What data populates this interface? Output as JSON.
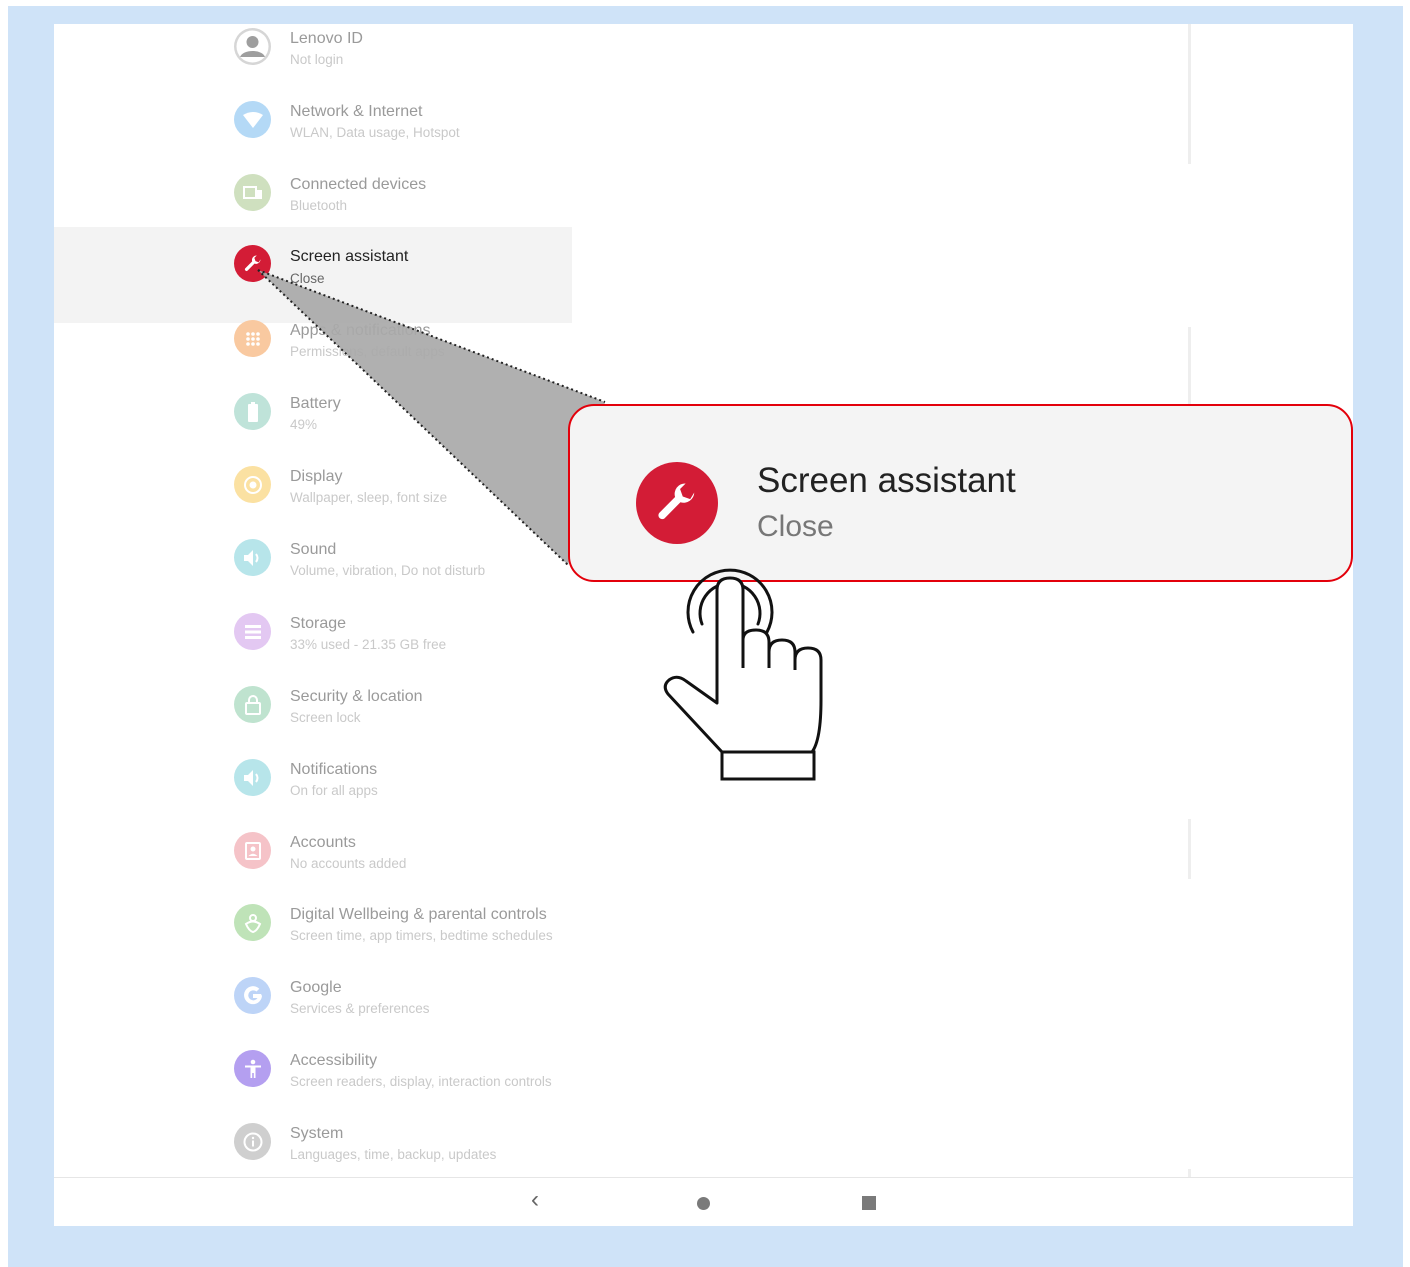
{
  "settings": {
    "items": [
      {
        "title": "Lenovo ID",
        "subtitle": "Not login",
        "icon": "account-icon",
        "color": "#c9c9c9"
      },
      {
        "title": "Network & Internet",
        "subtitle": "WLAN, Data usage, Hotspot",
        "icon": "wifi-icon",
        "color": "#b4d9f6"
      },
      {
        "title": "Connected devices",
        "subtitle": "Bluetooth",
        "icon": "devices-icon",
        "color": "#cfe0bf"
      },
      {
        "title": "Screen assistant",
        "subtitle": "Close",
        "icon": "wrench-icon",
        "color": "#d31c36"
      },
      {
        "title": "Apps & notifications",
        "subtitle": "Permissions, default apps",
        "icon": "apps-icon",
        "color": "#f9c9a0"
      },
      {
        "title": "Battery",
        "subtitle": "49%",
        "icon": "battery-icon",
        "color": "#bfe3d9"
      },
      {
        "title": "Display",
        "subtitle": "Wallpaper, sleep, font size",
        "icon": "brightness-icon",
        "color": "#fbe1a2"
      },
      {
        "title": "Sound",
        "subtitle": "Volume, vibration, Do not disturb",
        "icon": "volume-icon",
        "color": "#b7e5ea"
      },
      {
        "title": "Storage",
        "subtitle": "33% used - 21.35 GB free",
        "icon": "storage-icon",
        "color": "#e3c8f2"
      },
      {
        "title": "Security & location",
        "subtitle": "Screen lock",
        "icon": "lock-icon",
        "color": "#bfe3cf"
      },
      {
        "title": "Notifications",
        "subtitle": "On for all apps",
        "icon": "notification-icon",
        "color": "#b7e5ea"
      },
      {
        "title": "Accounts",
        "subtitle": "No accounts added",
        "icon": "accounts-icon",
        "color": "#f5c3c8"
      },
      {
        "title": "Digital Wellbeing & parental controls",
        "subtitle": "Screen time, app timers, bedtime schedules",
        "icon": "wellbeing-icon",
        "color": "#bfe3b8"
      },
      {
        "title": "Google",
        "subtitle": "Services & preferences",
        "icon": "google-icon",
        "color": "#bdd4f7"
      },
      {
        "title": "Accessibility",
        "subtitle": "Screen readers, display, interaction controls",
        "icon": "accessibility-icon",
        "color": "#c2aef0"
      },
      {
        "title": "System",
        "subtitle": "Languages, time, backup, updates",
        "icon": "info-icon",
        "color": "#cfcfcf"
      }
    ]
  },
  "callout": {
    "title": "Screen assistant",
    "subtitle": "Close",
    "accent": "#e3000b"
  },
  "navbar": {
    "back_glyph": "‹"
  }
}
